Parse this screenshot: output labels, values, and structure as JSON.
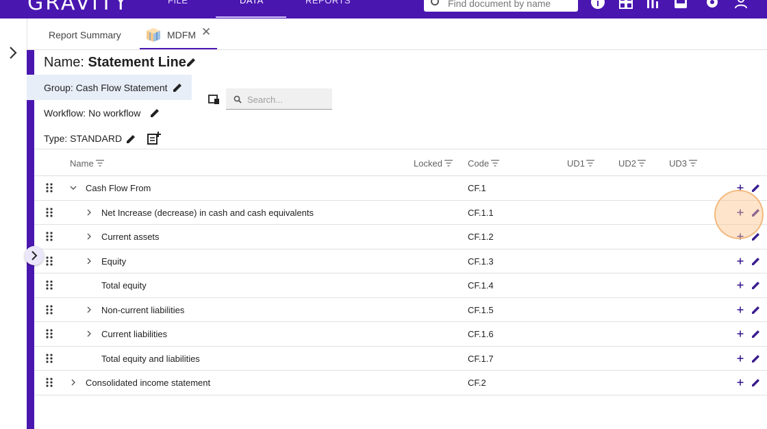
{
  "app": {
    "logo": "GRAVITY",
    "nav": [
      {
        "label": "FILE"
      },
      {
        "label": "DATA"
      },
      {
        "label": "REPORTS"
      }
    ],
    "search_placeholder": "Find document by name"
  },
  "tabs": {
    "summary_label": "Report Summary",
    "active_label": "MDFM",
    "close_glyph": "✕"
  },
  "properties": {
    "name_label": "Name:",
    "name_value": "Statement Line",
    "group": "Group: Cash Flow Statement",
    "workflow": "Workflow: No workflow",
    "type": "Type: STANDARD",
    "search_placeholder": "Search..."
  },
  "grid": {
    "columns": [
      {
        "label": "Name"
      },
      {
        "label": "Locked"
      },
      {
        "label": "Code"
      },
      {
        "label": "UD1"
      },
      {
        "label": "UD2"
      },
      {
        "label": "UD3"
      }
    ],
    "rows": [
      {
        "name": "Cash Flow From",
        "code": "CF.1",
        "level": 0,
        "expander": "expanded"
      },
      {
        "name": "Net Increase (decrease) in cash and cash equivalents",
        "code": "CF.1.1",
        "level": 1,
        "expander": "collapsed"
      },
      {
        "name": "Current assets",
        "code": "CF.1.2",
        "level": 1,
        "expander": "collapsed"
      },
      {
        "name": "Equity",
        "code": "CF.1.3",
        "level": 1,
        "expander": "collapsed"
      },
      {
        "name": "Total equity",
        "code": "CF.1.4",
        "level": 1,
        "expander": "none"
      },
      {
        "name": "Non-current liabilities",
        "code": "CF.1.5",
        "level": 1,
        "expander": "collapsed"
      },
      {
        "name": "Current liabilities",
        "code": "CF.1.6",
        "level": 1,
        "expander": "collapsed"
      },
      {
        "name": "Total equity and liabilities",
        "code": "CF.1.7",
        "level": 1,
        "expander": "none"
      },
      {
        "name": "Consolidated income statement",
        "code": "CF.2",
        "level": 0,
        "expander": "collapsed"
      }
    ]
  },
  "colors": {
    "brand": "#4a16b0",
    "highlight": "#e8eef8",
    "click_indicator": "#f5b77a"
  },
  "icons": [
    "search-icon",
    "info-icon",
    "grid-icon",
    "chart-icon",
    "inbox-icon",
    "gear-icon",
    "user-icon",
    "chevron-right-icon",
    "cube-icon",
    "pencil-icon",
    "note-add-icon",
    "filter-icon",
    "drag-handle-icon",
    "plus-icon"
  ]
}
